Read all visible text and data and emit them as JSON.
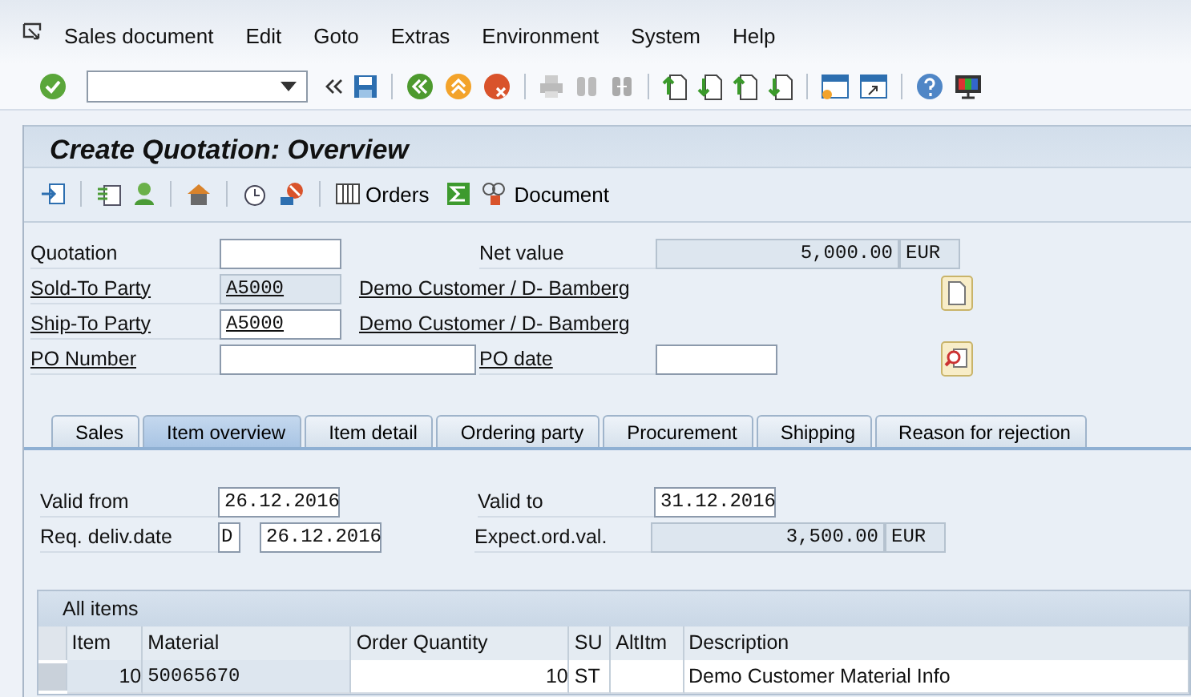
{
  "menu": [
    "Sales document",
    "Edit",
    "Goto",
    "Extras",
    "Environment",
    "System",
    "Help"
  ],
  "title": "Create Quotation: Overview",
  "app_toolbar": {
    "buttons": [
      "Orders",
      "Document"
    ]
  },
  "header": {
    "quotation": {
      "label": "Quotation",
      "link": false
    },
    "net_value": {
      "label": "Net value",
      "link": false,
      "value": "5,000.00",
      "currency": "EUR"
    },
    "sold_to": {
      "label": "Sold-To Party",
      "link": true,
      "value": "A5000",
      "editable": false,
      "name": "Demo Customer / D- Bamberg"
    },
    "ship_to": {
      "label": "Ship-To Party",
      "link": true,
      "value": "A5000",
      "editable": true,
      "name": "Demo Customer / D- Bamberg"
    },
    "po_number": {
      "label": "PO Number",
      "link": true
    },
    "po_date": {
      "label": "PO date",
      "link": true
    }
  },
  "tabs": [
    {
      "label": "Sales",
      "selected": false
    },
    {
      "label": "Item overview",
      "selected": true
    },
    {
      "label": "Item detail",
      "selected": false
    },
    {
      "label": "Ordering party",
      "selected": false
    },
    {
      "label": "Procurement",
      "selected": false
    },
    {
      "label": "Shipping",
      "selected": false
    },
    {
      "label": "Reason for rejection",
      "selected": false
    }
  ],
  "tab_content": {
    "valid_from": {
      "label": "Valid from",
      "value": "26.12.2016"
    },
    "valid_to": {
      "label": "Valid to",
      "value": "31.12.2016"
    },
    "req_deliv_date": {
      "label": "Req. deliv.date",
      "format": "D",
      "value": "26.12.2016"
    },
    "expect_ord_val": {
      "label": "Expect.ord.val.",
      "value": "3,500.00",
      "currency": "EUR"
    }
  },
  "table": {
    "title": "All items",
    "columns": [
      "Item",
      "Material",
      "Order Quantity",
      "SU",
      "AltItm",
      "Description"
    ],
    "rows": [
      {
        "item": "10",
        "material": "50065670",
        "order_quantity": "10",
        "su": "ST",
        "description": "Demo Customer Material Info"
      }
    ]
  }
}
